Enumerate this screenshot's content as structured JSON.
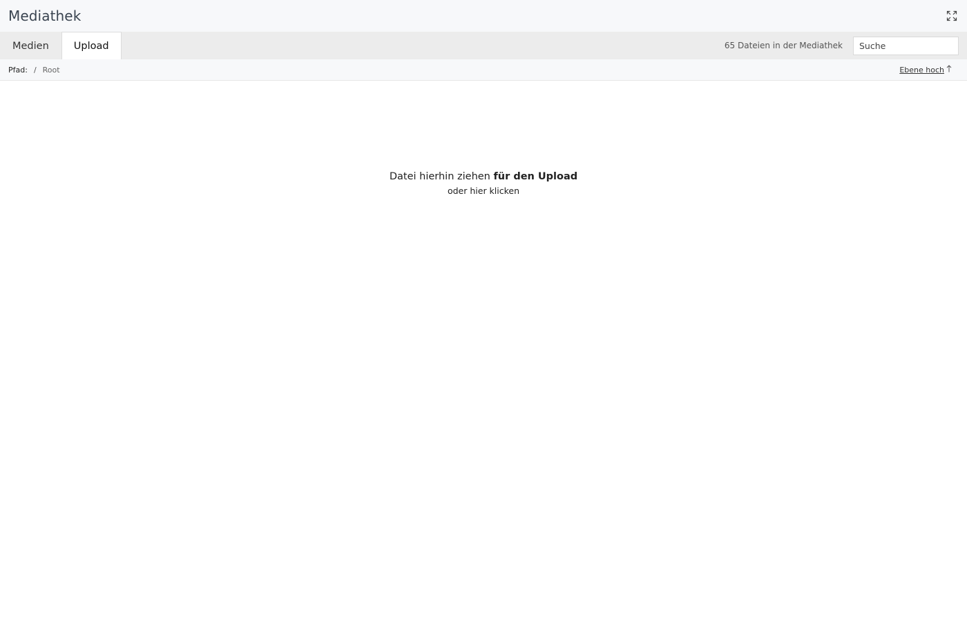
{
  "header": {
    "title": "Mediathek",
    "expand_icon": "expand-icon"
  },
  "tabs": [
    {
      "label": "Medien",
      "active": false
    },
    {
      "label": "Upload",
      "active": true
    }
  ],
  "toolbar": {
    "file_count": "65 Dateien in der Mediathek",
    "search_placeholder": "Suche"
  },
  "path": {
    "label": "Pfad:",
    "separator": "/",
    "root": "Root",
    "level_up": "Ebene hoch",
    "level_up_icon": "arrow-up-icon"
  },
  "dropzone": {
    "text_regular": "Datei hierhin ziehen ",
    "text_bold": "für den Upload",
    "text_secondary": "oder hier klicken"
  }
}
